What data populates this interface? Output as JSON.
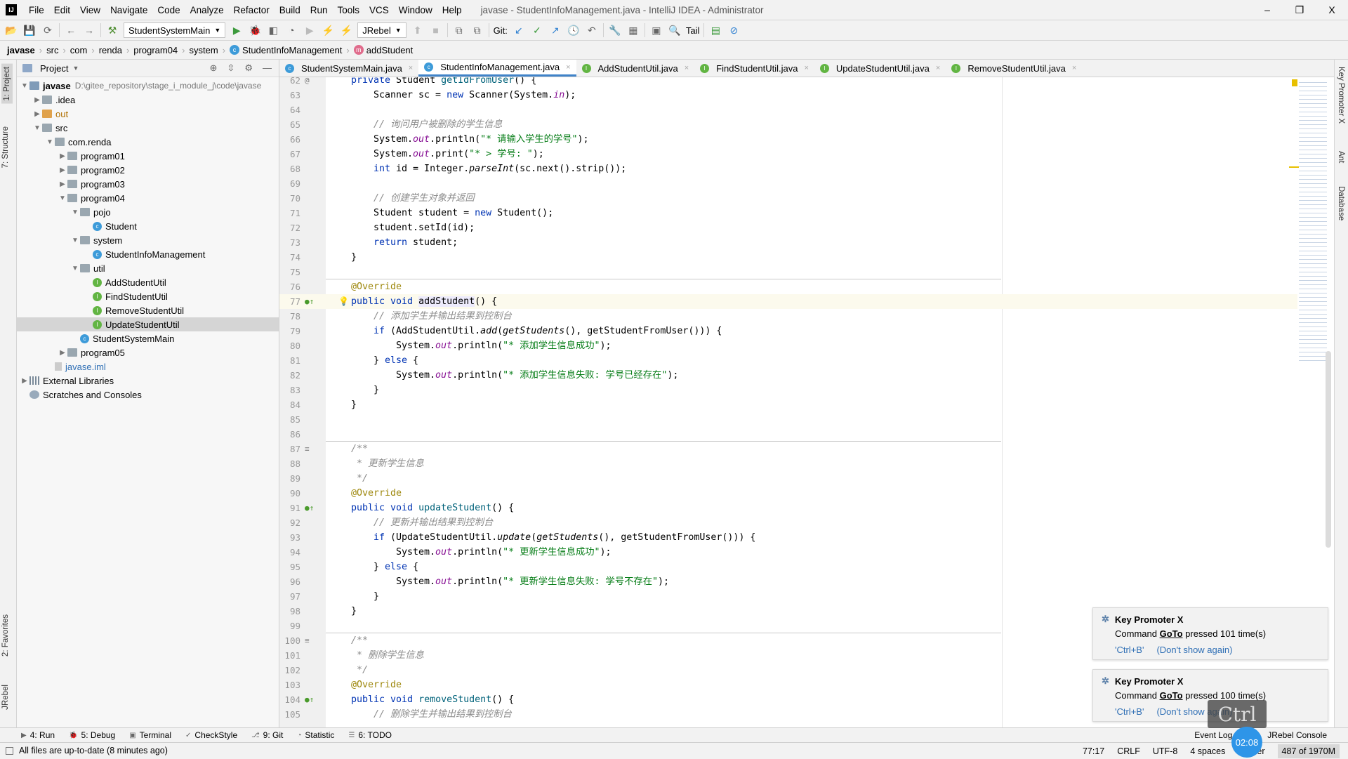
{
  "window": {
    "title": "javase - StudentInfoManagement.java - IntelliJ IDEA - Administrator",
    "logo": "IJ",
    "minimize": "–",
    "restore": "❐",
    "close": "X"
  },
  "menu": [
    "File",
    "Edit",
    "View",
    "Navigate",
    "Code",
    "Analyze",
    "Refactor",
    "Build",
    "Run",
    "Tools",
    "VCS",
    "Window",
    "Help"
  ],
  "toolbar": {
    "run_config": "StudentSystemMain",
    "jrebel": "JRebel",
    "git_label": "Git:",
    "tail": "Tail"
  },
  "breadcrumb": [
    "javase",
    "src",
    "com",
    "renda",
    "program04",
    "system",
    "StudentInfoManagement",
    "addStudent"
  ],
  "left_stripe": [
    "1: Project",
    "7: Structure",
    "2: Favorites",
    "JRebel"
  ],
  "right_stripe": [
    "Key Promoter X",
    "Ant",
    "Database"
  ],
  "project": {
    "title": "Project",
    "root_path": "D:\\gitee_repository\\stage_i_module_j\\code\\javase",
    "tree": [
      {
        "label": "javase",
        "depth": 0,
        "arrow": "▼",
        "icon": "module",
        "bold": true
      },
      {
        "label": ".idea",
        "depth": 1,
        "arrow": "▶",
        "icon": "folder"
      },
      {
        "label": "out",
        "depth": 1,
        "arrow": "▶",
        "icon": "folder-orange"
      },
      {
        "label": "src",
        "depth": 1,
        "arrow": "▼",
        "icon": "folder"
      },
      {
        "label": "com.renda",
        "depth": 2,
        "arrow": "▼",
        "icon": "folder"
      },
      {
        "label": "program01",
        "depth": 3,
        "arrow": "▶",
        "icon": "folder"
      },
      {
        "label": "program02",
        "depth": 3,
        "arrow": "▶",
        "icon": "folder"
      },
      {
        "label": "program03",
        "depth": 3,
        "arrow": "▶",
        "icon": "folder"
      },
      {
        "label": "program04",
        "depth": 3,
        "arrow": "▼",
        "icon": "folder"
      },
      {
        "label": "pojo",
        "depth": 4,
        "arrow": "▼",
        "icon": "folder"
      },
      {
        "label": "Student",
        "depth": 5,
        "arrow": "",
        "icon": "class"
      },
      {
        "label": "system",
        "depth": 4,
        "arrow": "▼",
        "icon": "folder"
      },
      {
        "label": "StudentInfoManagement",
        "depth": 5,
        "arrow": "",
        "icon": "class"
      },
      {
        "label": "util",
        "depth": 4,
        "arrow": "▼",
        "icon": "folder"
      },
      {
        "label": "AddStudentUtil",
        "depth": 5,
        "arrow": "",
        "icon": "interface"
      },
      {
        "label": "FindStudentUtil",
        "depth": 5,
        "arrow": "",
        "icon": "interface"
      },
      {
        "label": "RemoveStudentUtil",
        "depth": 5,
        "arrow": "",
        "icon": "interface"
      },
      {
        "label": "UpdateStudentUtil",
        "depth": 5,
        "arrow": "",
        "icon": "interface",
        "selected": true
      },
      {
        "label": "StudentSystemMain",
        "depth": 4,
        "arrow": "",
        "icon": "class-main"
      },
      {
        "label": "program05",
        "depth": 3,
        "arrow": "▶",
        "icon": "folder"
      },
      {
        "label": "javase.iml",
        "depth": 2,
        "arrow": "",
        "icon": "file"
      },
      {
        "label": "External Libraries",
        "depth": 0,
        "arrow": "▶",
        "icon": "library"
      },
      {
        "label": "Scratches and Consoles",
        "depth": 0,
        "arrow": "",
        "icon": "scratch"
      }
    ]
  },
  "tabs": [
    {
      "label": "StudentSystemMain.java",
      "icon": "class"
    },
    {
      "label": "StudentInfoManagement.java",
      "icon": "class",
      "active": true
    },
    {
      "label": "AddStudentUtil.java",
      "icon": "interface"
    },
    {
      "label": "FindStudentUtil.java",
      "icon": "interface"
    },
    {
      "label": "UpdateStudentUtil.java",
      "icon": "interface"
    },
    {
      "label": "RemoveStudentUtil.java",
      "icon": "interface"
    }
  ],
  "editor": {
    "current_line": 77,
    "lines": [
      {
        "n": 62,
        "ind": 0,
        "g": "@",
        "t": [
          [
            "private ",
            "k"
          ],
          [
            "Student ",
            ""
          ],
          [
            "getIdFromUser",
            "f"
          ],
          [
            "() {",
            ""
          ]
        ]
      },
      {
        "n": 63,
        "ind": 1,
        "t": [
          [
            "Scanner sc = ",
            ""
          ],
          [
            "new ",
            "k"
          ],
          [
            "Scanner(System.",
            ""
          ],
          [
            "in",
            "i"
          ],
          [
            ");",
            ""
          ]
        ]
      },
      {
        "n": 64,
        "t": []
      },
      {
        "n": 65,
        "ind": 1,
        "t": [
          [
            "// 询问用户被删除的学生信息",
            "c"
          ]
        ]
      },
      {
        "n": 66,
        "ind": 1,
        "t": [
          [
            "System.",
            ""
          ],
          [
            "out",
            "i"
          ],
          [
            ".println(",
            ""
          ],
          [
            "\"* 请输入学生的学号\"",
            "s"
          ],
          [
            ");",
            ""
          ]
        ]
      },
      {
        "n": 67,
        "ind": 1,
        "t": [
          [
            "System.",
            ""
          ],
          [
            "out",
            "i"
          ],
          [
            ".print(",
            ""
          ],
          [
            "\"* > 学号: \"",
            "s"
          ],
          [
            ");",
            ""
          ]
        ]
      },
      {
        "n": 68,
        "ind": 1,
        "t": [
          [
            "int ",
            "k"
          ],
          [
            "id = Integer.",
            ""
          ],
          [
            "parseInt",
            "m"
          ],
          [
            "(sc.next().strip());",
            ""
          ]
        ]
      },
      {
        "n": 69,
        "t": []
      },
      {
        "n": 70,
        "ind": 1,
        "t": [
          [
            "// 创建学生对象并返回",
            "c"
          ]
        ]
      },
      {
        "n": 71,
        "ind": 1,
        "t": [
          [
            "Student student = ",
            ""
          ],
          [
            "new ",
            "k"
          ],
          [
            "Student();",
            ""
          ]
        ]
      },
      {
        "n": 72,
        "ind": 1,
        "t": [
          [
            "student.setId(id);",
            ""
          ]
        ]
      },
      {
        "n": 73,
        "ind": 1,
        "t": [
          [
            "return ",
            "k"
          ],
          [
            "student;",
            ""
          ]
        ]
      },
      {
        "n": 74,
        "ind": 0,
        "t": [
          [
            "}",
            ""
          ]
        ]
      },
      {
        "n": 75,
        "t": []
      },
      {
        "n": 76,
        "ind": 0,
        "sep": true,
        "t": [
          [
            "@Override",
            "a"
          ]
        ]
      },
      {
        "n": 77,
        "ind": 0,
        "g": "impl",
        "t": [
          [
            "public void ",
            "k"
          ],
          [
            "addStudent",
            "hl"
          ],
          [
            "() {",
            ""
          ]
        ]
      },
      {
        "n": 78,
        "ind": 1,
        "t": [
          [
            "// 添加学生并输出结果到控制台",
            "c"
          ]
        ]
      },
      {
        "n": 79,
        "ind": 1,
        "t": [
          [
            "if ",
            "k"
          ],
          [
            "(AddStudentUtil.",
            ""
          ],
          [
            "add",
            "m"
          ],
          [
            "(",
            ""
          ],
          [
            "getStudents",
            "m"
          ],
          [
            "(), getStudentFromUser())) {",
            ""
          ]
        ]
      },
      {
        "n": 80,
        "ind": 2,
        "t": [
          [
            "System.",
            ""
          ],
          [
            "out",
            "i"
          ],
          [
            ".println(",
            ""
          ],
          [
            "\"* 添加学生信息成功\"",
            "s"
          ],
          [
            ");",
            ""
          ]
        ]
      },
      {
        "n": 81,
        "ind": 1,
        "t": [
          [
            "} ",
            ""
          ],
          [
            "else ",
            "k"
          ],
          [
            "{",
            ""
          ]
        ]
      },
      {
        "n": 82,
        "ind": 2,
        "t": [
          [
            "System.",
            ""
          ],
          [
            "out",
            "i"
          ],
          [
            ".println(",
            ""
          ],
          [
            "\"* 添加学生信息失败: 学号已经存在\"",
            "s"
          ],
          [
            ");",
            ""
          ]
        ]
      },
      {
        "n": 83,
        "ind": 1,
        "t": [
          [
            "}",
            ""
          ]
        ]
      },
      {
        "n": 84,
        "ind": 0,
        "t": [
          [
            "}",
            ""
          ]
        ]
      },
      {
        "n": 85,
        "t": []
      },
      {
        "n": 86,
        "t": []
      },
      {
        "n": 87,
        "ind": 0,
        "sep": true,
        "g": "doc",
        "t": [
          [
            "/**",
            "c"
          ]
        ]
      },
      {
        "n": 88,
        "ind": 0,
        "t": [
          [
            " * 更新学生信息",
            "c"
          ]
        ]
      },
      {
        "n": 89,
        "ind": 0,
        "t": [
          [
            " */",
            "c"
          ]
        ]
      },
      {
        "n": 90,
        "ind": 0,
        "t": [
          [
            "@Override",
            "a"
          ]
        ]
      },
      {
        "n": 91,
        "ind": 0,
        "g": "impl",
        "t": [
          [
            "public void ",
            "k"
          ],
          [
            "updateStudent",
            "f"
          ],
          [
            "() {",
            ""
          ]
        ]
      },
      {
        "n": 92,
        "ind": 1,
        "t": [
          [
            "// 更新并输出结果到控制台",
            "c"
          ]
        ]
      },
      {
        "n": 93,
        "ind": 1,
        "t": [
          [
            "if ",
            "k"
          ],
          [
            "(UpdateStudentUtil.",
            ""
          ],
          [
            "update",
            "m"
          ],
          [
            "(",
            ""
          ],
          [
            "getStudents",
            "m"
          ],
          [
            "(), getStudentFromUser())) {",
            ""
          ]
        ]
      },
      {
        "n": 94,
        "ind": 2,
        "t": [
          [
            "System.",
            ""
          ],
          [
            "out",
            "i"
          ],
          [
            ".println(",
            ""
          ],
          [
            "\"* 更新学生信息成功\"",
            "s"
          ],
          [
            ");",
            ""
          ]
        ]
      },
      {
        "n": 95,
        "ind": 1,
        "t": [
          [
            "} ",
            ""
          ],
          [
            "else ",
            "k"
          ],
          [
            "{",
            ""
          ]
        ]
      },
      {
        "n": 96,
        "ind": 2,
        "t": [
          [
            "System.",
            ""
          ],
          [
            "out",
            "i"
          ],
          [
            ".println(",
            ""
          ],
          [
            "\"* 更新学生信息失败: 学号不存在\"",
            "s"
          ],
          [
            ");",
            ""
          ]
        ]
      },
      {
        "n": 97,
        "ind": 1,
        "t": [
          [
            "}",
            ""
          ]
        ]
      },
      {
        "n": 98,
        "ind": 0,
        "t": [
          [
            "}",
            ""
          ]
        ]
      },
      {
        "n": 99,
        "t": []
      },
      {
        "n": 100,
        "ind": 0,
        "sep": true,
        "g": "doc",
        "t": [
          [
            "/**",
            "c"
          ]
        ]
      },
      {
        "n": 101,
        "ind": 0,
        "t": [
          [
            " * 删除学生信息",
            "c"
          ]
        ]
      },
      {
        "n": 102,
        "ind": 0,
        "t": [
          [
            " */",
            "c"
          ]
        ]
      },
      {
        "n": 103,
        "ind": 0,
        "t": [
          [
            "@Override",
            "a"
          ]
        ]
      },
      {
        "n": 104,
        "ind": 0,
        "g": "impl",
        "t": [
          [
            "public void ",
            "k"
          ],
          [
            "removeStudent",
            "f"
          ],
          [
            "() {",
            ""
          ]
        ]
      },
      {
        "n": 105,
        "ind": 1,
        "t": [
          [
            "// 删除学生并输出结果到控制台",
            "c"
          ]
        ]
      }
    ]
  },
  "bottom_tools": [
    "4: Run",
    "5: Debug",
    "Terminal",
    "CheckStyle",
    "9: Git",
    "Statistic",
    "6: TODO"
  ],
  "bottom_right": {
    "event_log": "Event Log",
    "jrebel_console": "JRebel Console"
  },
  "status": {
    "message": "All files are up-to-date (8 minutes ago)",
    "position": "77:17",
    "line_sep": "CRLF",
    "encoding": "UTF-8",
    "indent": "4 spaces",
    "branch": "master",
    "memory": "487 of 1970M"
  },
  "notifications": [
    {
      "title": "Key Promoter X",
      "prefix": "Command ",
      "command": "GoTo",
      "suffix": " pressed 101 time(s)",
      "shortcut": "'Ctrl+B'",
      "dismiss": "(Don't show again)"
    },
    {
      "title": "Key Promoter X",
      "prefix": "Command ",
      "command": "GoTo",
      "suffix": " pressed 100 time(s)",
      "shortcut": "'Ctrl+B'",
      "dismiss": "(Don't show again)"
    }
  ],
  "overlay": {
    "key": "Ctrl",
    "timer": "02:08"
  },
  "colors": {
    "keyword": "#0033b3",
    "string": "#067d17",
    "comment": "#8c8c8c",
    "annotation": "#9e880d",
    "accent": "#4083c9"
  }
}
